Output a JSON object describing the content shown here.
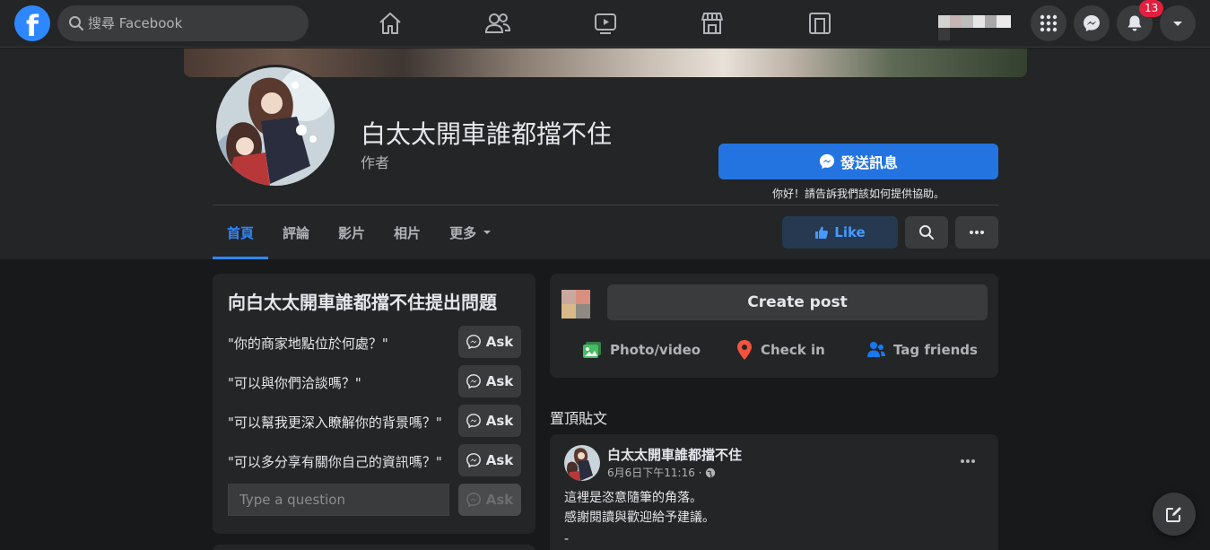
{
  "search": {
    "placeholder": "搜尋 Facebook"
  },
  "notifications": {
    "count": "13"
  },
  "page": {
    "name": "白太太開車誰都擋不住",
    "category": "作者",
    "send_message_label": "發送訊息",
    "send_message_hint": "你好！請告訴我們該如何提供協助。",
    "like_label": "Like"
  },
  "tabs": [
    {
      "label": "首頁"
    },
    {
      "label": "評論"
    },
    {
      "label": "影片"
    },
    {
      "label": "相片"
    },
    {
      "label": "更多"
    }
  ],
  "ask": {
    "title": "向白太太開車誰都擋不住提出問題",
    "questions": [
      {
        "text": "\"你的商家地點位於何處？\"",
        "button": "Ask"
      },
      {
        "text": "\"可以與你們洽談嗎？\"",
        "button": "Ask"
      },
      {
        "text": "\"可以幫我更深入瞭解你的背景嗎？\"",
        "button": "Ask"
      },
      {
        "text": "\"可以多分享有關你自己的資訊嗎？\"",
        "button": "Ask"
      }
    ],
    "input_placeholder": "Type a question",
    "submit_label": "Ask"
  },
  "composer": {
    "create_post_label": "Create post",
    "actions": [
      {
        "label": "Photo/video",
        "icon": "photo-video-icon",
        "color": "#45bd62"
      },
      {
        "label": "Check in",
        "icon": "location-pin-icon",
        "color": "#f5533d"
      },
      {
        "label": "Tag friends",
        "icon": "tag-friends-icon",
        "color": "#1877f2"
      }
    ]
  },
  "pinned": {
    "label": "置頂貼文",
    "post": {
      "author": "白太太開車誰都擋不住",
      "time": "6月6日下午11:16 ·",
      "lines": [
        "這裡是恣意隨筆的角落。",
        "感謝閱讀與歡迎給予建議。",
        "-"
      ]
    }
  },
  "colors": {
    "accent": "#2d88ff",
    "primary_button": "#2374e1",
    "badge": "#e41e3f",
    "surface": "#242526",
    "background": "#18191a"
  }
}
